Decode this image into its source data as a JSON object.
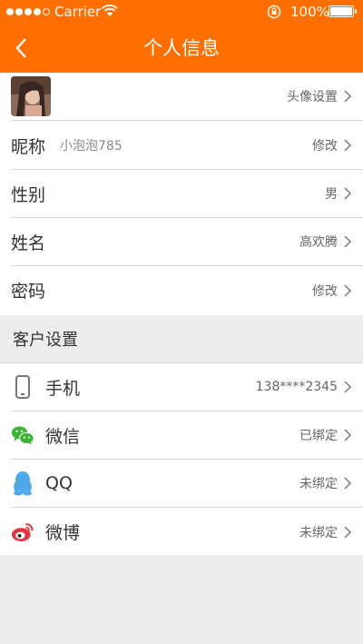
{
  "status": {
    "carrier": "Carrier",
    "battery": "100%"
  },
  "header": {
    "title": "个人信息"
  },
  "profile": [
    {
      "label": "",
      "sub": "",
      "right": "头像设置"
    },
    {
      "label": "昵称",
      "sub": "小泡泡785",
      "right": "修改"
    },
    {
      "label": "性别",
      "sub": "",
      "right": "男"
    },
    {
      "label": "姓名",
      "sub": "",
      "right": "高欢腾"
    },
    {
      "label": "密码",
      "sub": "",
      "right": "修改"
    }
  ],
  "section": {
    "title": "客户设置"
  },
  "bindings": [
    {
      "label": "手机",
      "right": "138****2345",
      "icon": "phone-icon"
    },
    {
      "label": "微信",
      "right": "已绑定",
      "icon": "wechat-icon"
    },
    {
      "label": "QQ",
      "right": "未绑定",
      "icon": "qq-icon"
    },
    {
      "label": "微博",
      "right": "未绑定",
      "icon": "weibo-icon"
    }
  ],
  "colors": {
    "accent": "#ff6f00",
    "wechat": "#3bb634",
    "qq": "#4fa9e8",
    "weibo": "#e2353f"
  }
}
